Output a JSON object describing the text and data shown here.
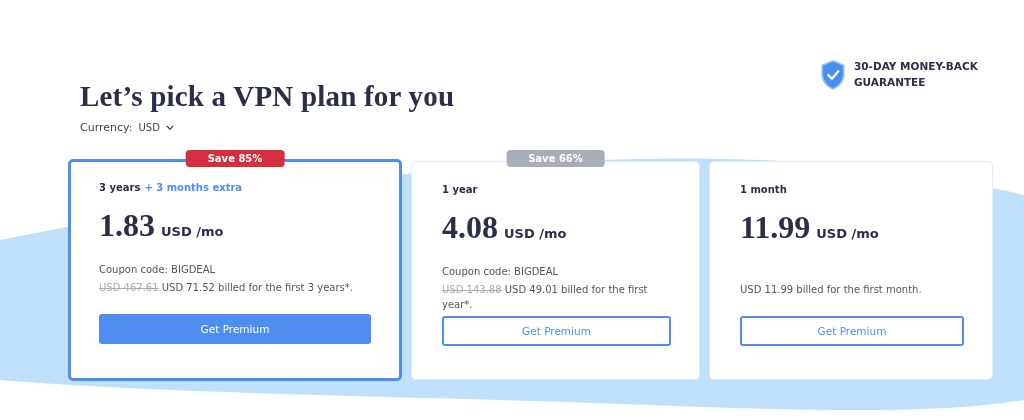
{
  "heading": "Let’s pick a VPN plan for you",
  "guarantee": {
    "text": "30-DAY MONEY-BACK GUARANTEE"
  },
  "currency": {
    "label": "Currency:",
    "value": "USD"
  },
  "plans": [
    {
      "selected": true,
      "badge": {
        "text": "Save 85%",
        "color": "#d32f3f"
      },
      "term": "3 years",
      "extra": "+ 3 months extra",
      "price": "1.83",
      "unit": "USD /mo",
      "coupon": "Coupon code: BIGDEAL",
      "old_price": "USD 467.61",
      "billing": "USD 71.52 billed for the first 3 years*.",
      "button": "Get Premium"
    },
    {
      "selected": false,
      "badge": {
        "text": "Save 66%",
        "color": "#a9adb8"
      },
      "term": "1 year",
      "price": "4.08",
      "unit": "USD /mo",
      "coupon": "Coupon code: BIGDEAL",
      "old_price": "USD 143.88",
      "billing": "USD 49.01 billed for the first year*.",
      "button": "Get Premium"
    },
    {
      "selected": false,
      "term": "1 month",
      "price": "11.99",
      "unit": "USD /mo",
      "billing": "USD 11.99 billed for the first month.",
      "button": "Get Premium"
    }
  ]
}
